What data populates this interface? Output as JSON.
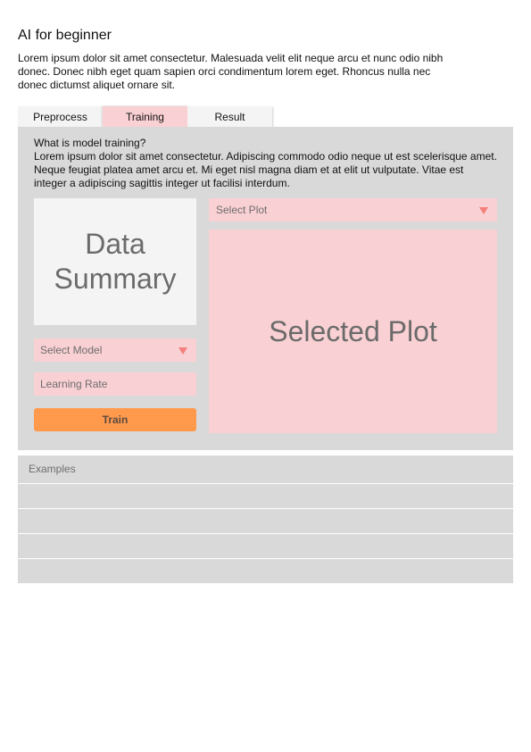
{
  "header": {
    "title": "AI for beginner",
    "intro": "Lorem ipsum dolor sit amet consectetur. Malesuada velit elit neque arcu et nunc odio nibh donec. Donec nibh eget quam sapien orci condimentum lorem eget. Rhoncus nulla nec donec dictumst aliquet ornare sit."
  },
  "tabs": [
    {
      "label": "Preprocess",
      "active": false
    },
    {
      "label": "Training",
      "active": true
    },
    {
      "label": "Result",
      "active": false
    }
  ],
  "training": {
    "heading": "What is model training?",
    "text": "Lorem ipsum dolor sit amet consectetur. Adipiscing commodo odio neque ut est scelerisque amet. Neque feugiat platea amet arcu et. Mi eget nisl magna diam et at elit ut vulputate. Vitae est integer a adipiscing sagittis integer ut facilisi interdum.",
    "data_summary_label": "Data Summary",
    "select_model_label": "Select Model",
    "learning_rate_placeholder": "Learning Rate",
    "train_label": "Train",
    "select_plot_label": "Select Plot",
    "plot_placeholder": "Selected Plot"
  },
  "examples": {
    "label": "Examples",
    "rows": [
      "",
      "",
      "",
      ""
    ]
  },
  "colors": {
    "panel_background": "#d9d9d9",
    "accent_pink": "#f9d0d3",
    "train_button": "#ff9a4d",
    "dropdown_caret": "#f47f7b"
  },
  "icons": {
    "dropdown": "caret-down-icon"
  }
}
